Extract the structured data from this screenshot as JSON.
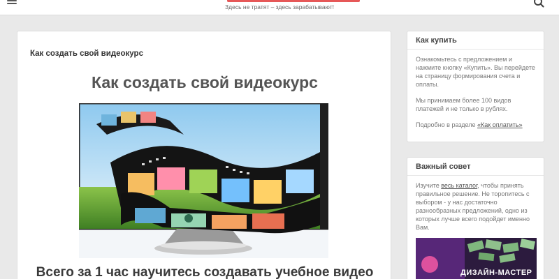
{
  "header": {
    "tagline": "Здесь не тратят – здесь зарабатывают!",
    "menu_icon": "hamburger-icon",
    "search_icon": "search-icon",
    "brand_color": "#e23b3b"
  },
  "main": {
    "breadcrumb": "Как создать свой видеокурс",
    "title": "Как создать свой видеокурс",
    "subtitle": "Всего за 1 час научитесь создавать учебное видео"
  },
  "sidebar": {
    "buy": {
      "title": "Как купить",
      "p1": "Ознакомьтесь с предложением и нажмите кнопку «Купить». Вы перейдете на страницу формирования счета и оплаты.",
      "p2": "Мы принимаем более 100 видов платежей и не только в рублях.",
      "p3_prefix": "Подробно в разделе ",
      "p3_link": "«Как оплатить»"
    },
    "advice": {
      "title": "Важный совет",
      "text_prefix": "Изучите ",
      "link": "весь каталог",
      "text_suffix": ", чтобы принять правильное решение. Не торопитесь с выбором - у нас достаточно разнообразных предложений, одно из которых лучше всего подойдет именно Вам.",
      "promo_title": "ДИЗАЙН-МАСТЕР"
    }
  }
}
